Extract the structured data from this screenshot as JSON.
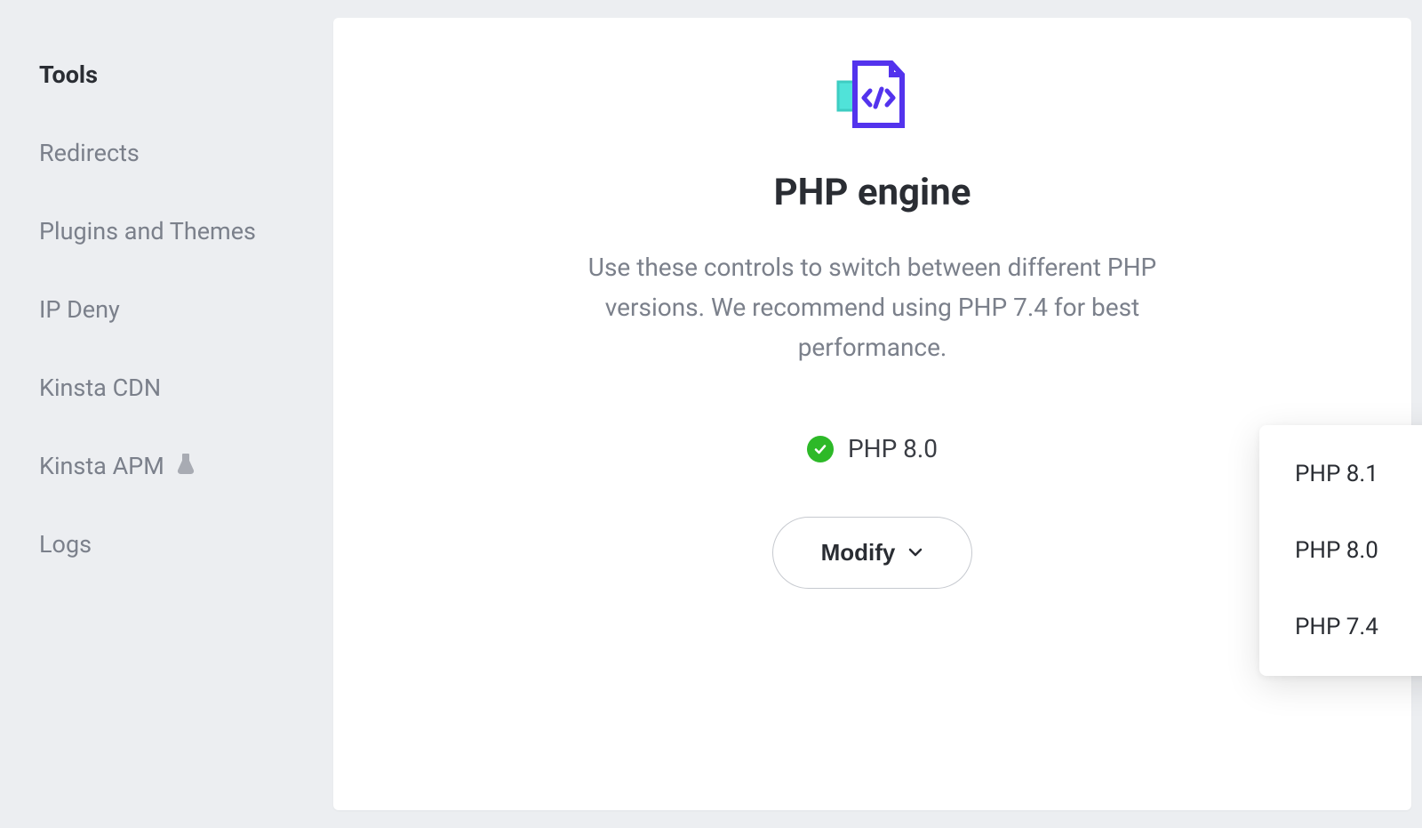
{
  "sidebar": {
    "items": [
      {
        "label": "Tools",
        "active": true
      },
      {
        "label": "Redirects",
        "active": false
      },
      {
        "label": "Plugins and Themes",
        "active": false
      },
      {
        "label": "IP Deny",
        "active": false
      },
      {
        "label": "Kinsta CDN",
        "active": false
      },
      {
        "label": "Kinsta APM",
        "active": false,
        "icon": "flask-icon"
      },
      {
        "label": "Logs",
        "active": false
      }
    ]
  },
  "panel": {
    "title": "PHP engine",
    "description": "Use these controls to switch between different PHP versions. We recommend using PHP 7.4 for best performance.",
    "current_version": "PHP 8.0",
    "modify_label": "Modify",
    "dropdown_options": [
      "PHP 8.1",
      "PHP 8.0",
      "PHP 7.4"
    ]
  }
}
